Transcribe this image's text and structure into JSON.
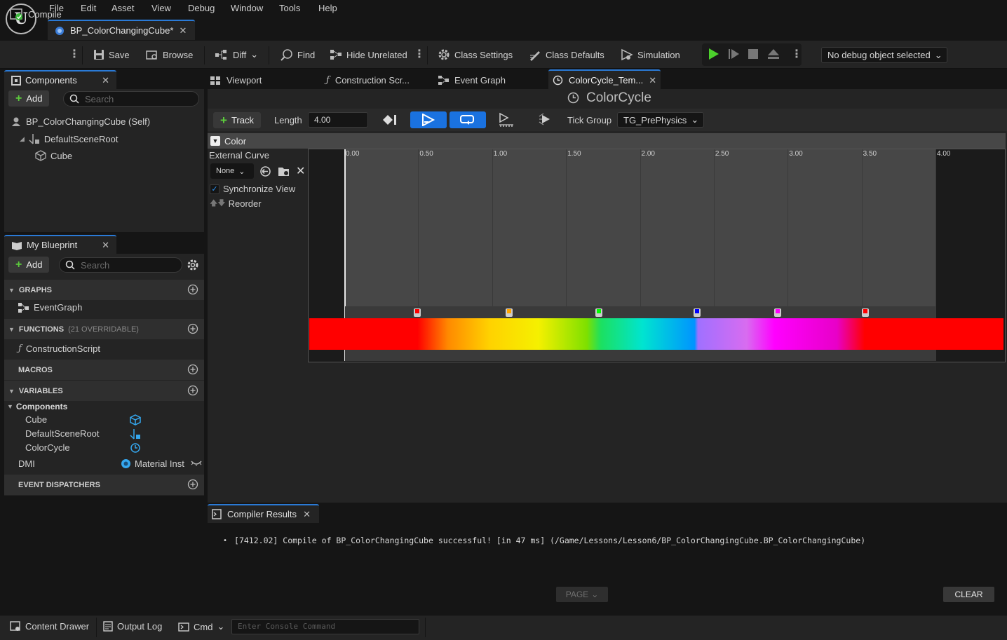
{
  "menu": [
    "File",
    "Edit",
    "Asset",
    "View",
    "Debug",
    "Window",
    "Tools",
    "Help"
  ],
  "document_tab": "BP_ColorChangingCube*",
  "toolbar": {
    "compile": "Compile",
    "save": "Save",
    "browse": "Browse",
    "diff": "Diff",
    "find": "Find",
    "hide_unrelated": "Hide Unrelated",
    "class_settings": "Class Settings",
    "class_defaults": "Class Defaults",
    "simulation": "Simulation",
    "debug_object": "No debug object selected"
  },
  "components_panel": {
    "title": "Components",
    "add": "Add",
    "search_placeholder": "Search",
    "tree": [
      "BP_ColorChangingCube (Self)",
      "DefaultSceneRoot",
      "Cube"
    ]
  },
  "my_blueprint": {
    "title": "My Blueprint",
    "add": "Add",
    "search_placeholder": "Search",
    "graphs": "GRAPHS",
    "event_graph": "EventGraph",
    "functions": "FUNCTIONS",
    "functions_note": "(21 OVERRIDABLE)",
    "construction_script": "ConstructionScript",
    "macros": "MACROS",
    "variables": "VARIABLES",
    "components_group": "Components",
    "vars": [
      "Cube",
      "DefaultSceneRoot",
      "ColorCycle"
    ],
    "dmi_name": "DMI",
    "dmi_type": "Material Inst",
    "event_dispatchers": "EVENT DISPATCHERS"
  },
  "main_tabs": [
    "Viewport",
    "Construction Scr...",
    "Event Graph",
    "ColorCycle_Tem..."
  ],
  "timeline": {
    "name": "ColorCycle",
    "track_btn": "Track",
    "length_label": "Length",
    "length_value": "4.00",
    "tick_group_label": "Tick Group",
    "tick_group_value": "TG_PrePhysics",
    "track_name": "Color",
    "external_curve": "External Curve",
    "curve_select": "None",
    "sync_view": "Synchronize View",
    "sync_checked": true,
    "reorder": "Reorder",
    "ticks": [
      "0.00",
      "0.50",
      "1.00",
      "1.50",
      "2.00",
      "2.50",
      "3.00",
      "3.50",
      "4.00"
    ],
    "keys": [
      {
        "time": 0.49,
        "color": "#ff0000"
      },
      {
        "time": 1.11,
        "color": "#ffa500"
      },
      {
        "time": 1.72,
        "color": "#00ff00"
      },
      {
        "time": 2.38,
        "color": "#0000ff"
      },
      {
        "time": 2.93,
        "color": "#ff00ff"
      },
      {
        "time": 3.52,
        "color": "#ff0000"
      }
    ]
  },
  "compiler": {
    "tab": "Compiler Results",
    "message": "[7412.02] Compile of BP_ColorChangingCube successful! [in 47 ms] (/Game/Lessons/Lesson6/BP_ColorChangingCube.BP_ColorChangingCube)",
    "page": "PAGE",
    "clear": "CLEAR"
  },
  "statusbar": {
    "content_drawer": "Content Drawer",
    "output_log": "Output Log",
    "cmd": "Cmd",
    "console_placeholder": "Enter Console Command"
  },
  "colors": {
    "accent": "#2a7ad6",
    "play": "#4cd02c",
    "blue_button": "#1a72e0"
  }
}
